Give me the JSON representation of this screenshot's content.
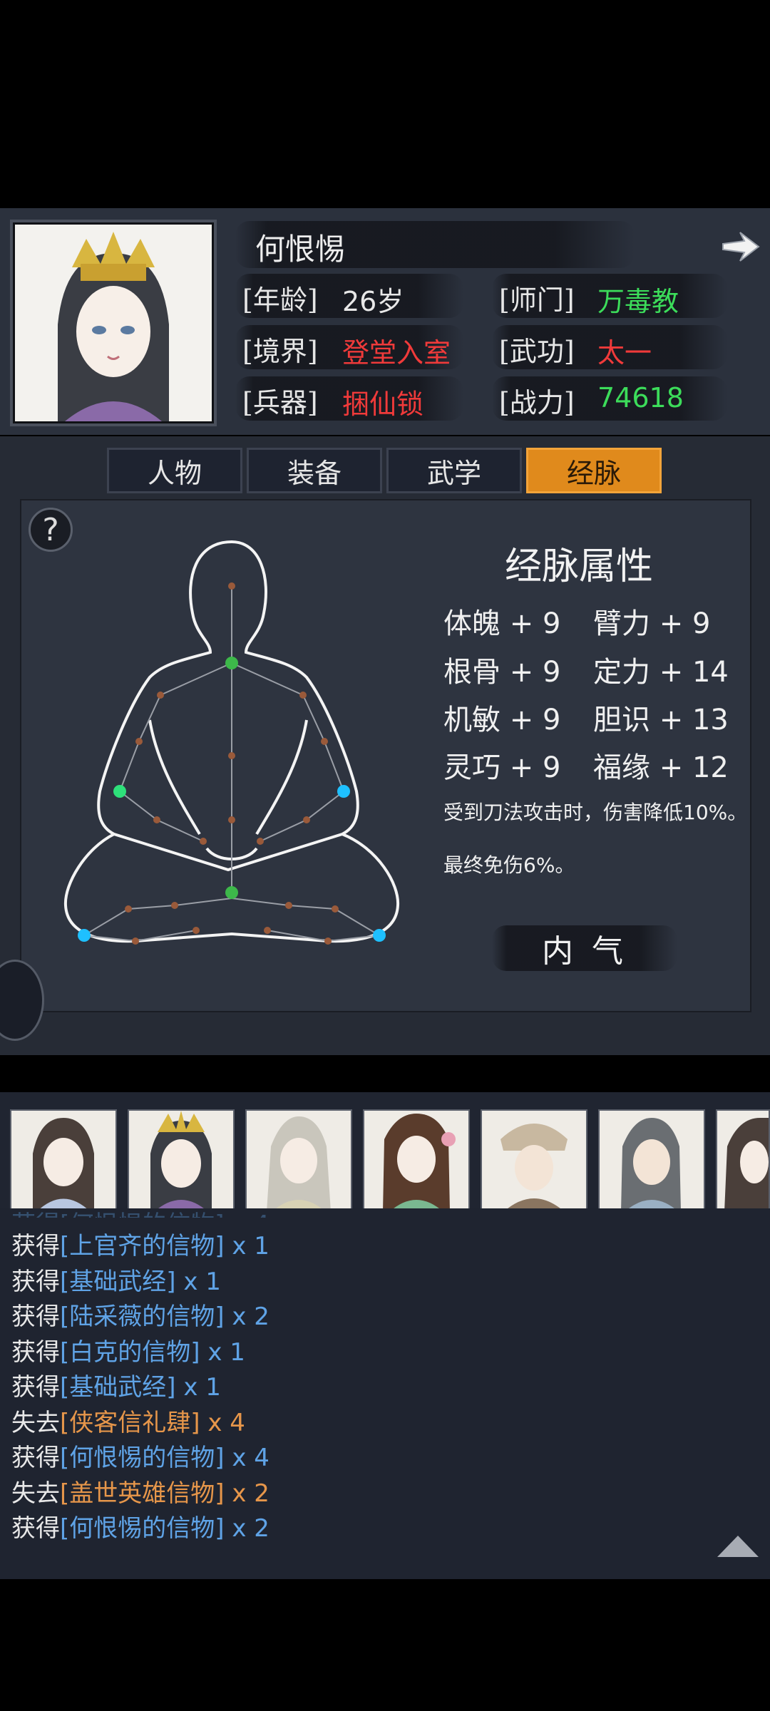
{
  "character": {
    "name": "何恨惕",
    "fields": {
      "age_label": "[年龄]",
      "age_value": "26岁",
      "sect_label": "[师门]",
      "sect_value": "万毒教",
      "realm_label": "[境界]",
      "realm_value": "登堂入室",
      "skill_label": "[武功]",
      "skill_value": "太一",
      "weapon_label": "[兵器]",
      "weapon_value": "捆仙锁",
      "power_label": "[战力]",
      "power_value": "74618"
    }
  },
  "tabs": [
    {
      "label": "人物",
      "active": false
    },
    {
      "label": "装备",
      "active": false
    },
    {
      "label": "武学",
      "active": false
    },
    {
      "label": "经脉",
      "active": true
    }
  ],
  "meridian": {
    "title": "经脉属性",
    "attributes": [
      {
        "left": "体魄 + 9",
        "right": "臂力 + 9"
      },
      {
        "left": "根骨 + 9",
        "right": "定力 + 14"
      },
      {
        "left": "机敏 + 9",
        "right": "胆识 + 13"
      },
      {
        "left": "灵巧 + 9",
        "right": "福缘 + 12"
      }
    ],
    "effect1": "受到刀法攻击时，伤害降低10%。",
    "effect2": "最终免伤6%。",
    "neiqi_button": "内 气",
    "help": "?"
  },
  "log": [
    {
      "verb": "获得",
      "item": "[上官齐的信物]",
      "qty": "x 1",
      "color": "blue"
    },
    {
      "verb": "获得",
      "item": "[基础武经]",
      "qty": "x 1",
      "color": "blue"
    },
    {
      "verb": "获得",
      "item": "[陆采薇的信物]",
      "qty": "x 2",
      "color": "blue"
    },
    {
      "verb": "获得",
      "item": "[白克的信物]",
      "qty": "x 1",
      "color": "blue"
    },
    {
      "verb": "获得",
      "item": "[基础武经]",
      "qty": "x 1",
      "color": "blue"
    },
    {
      "verb": "失去",
      "item": "[侠客信礼肆]",
      "qty": "x 4",
      "color": "orange"
    },
    {
      "verb": "获得",
      "item": "[何恨惕的信物]",
      "qty": "x 4",
      "color": "blue"
    },
    {
      "verb": "失去",
      "item": "[盖世英雄信物]",
      "qty": "x 2",
      "color": "orange"
    },
    {
      "verb": "获得",
      "item": "[何恨惕的信物]",
      "qty": "x 2",
      "color": "blue"
    }
  ],
  "colors": {
    "green": "#3cdc5a",
    "red": "#f03a3a",
    "orange_tab": "#e08a1c",
    "log_blue": "#5fa3e6",
    "log_orange": "#e6964a"
  }
}
